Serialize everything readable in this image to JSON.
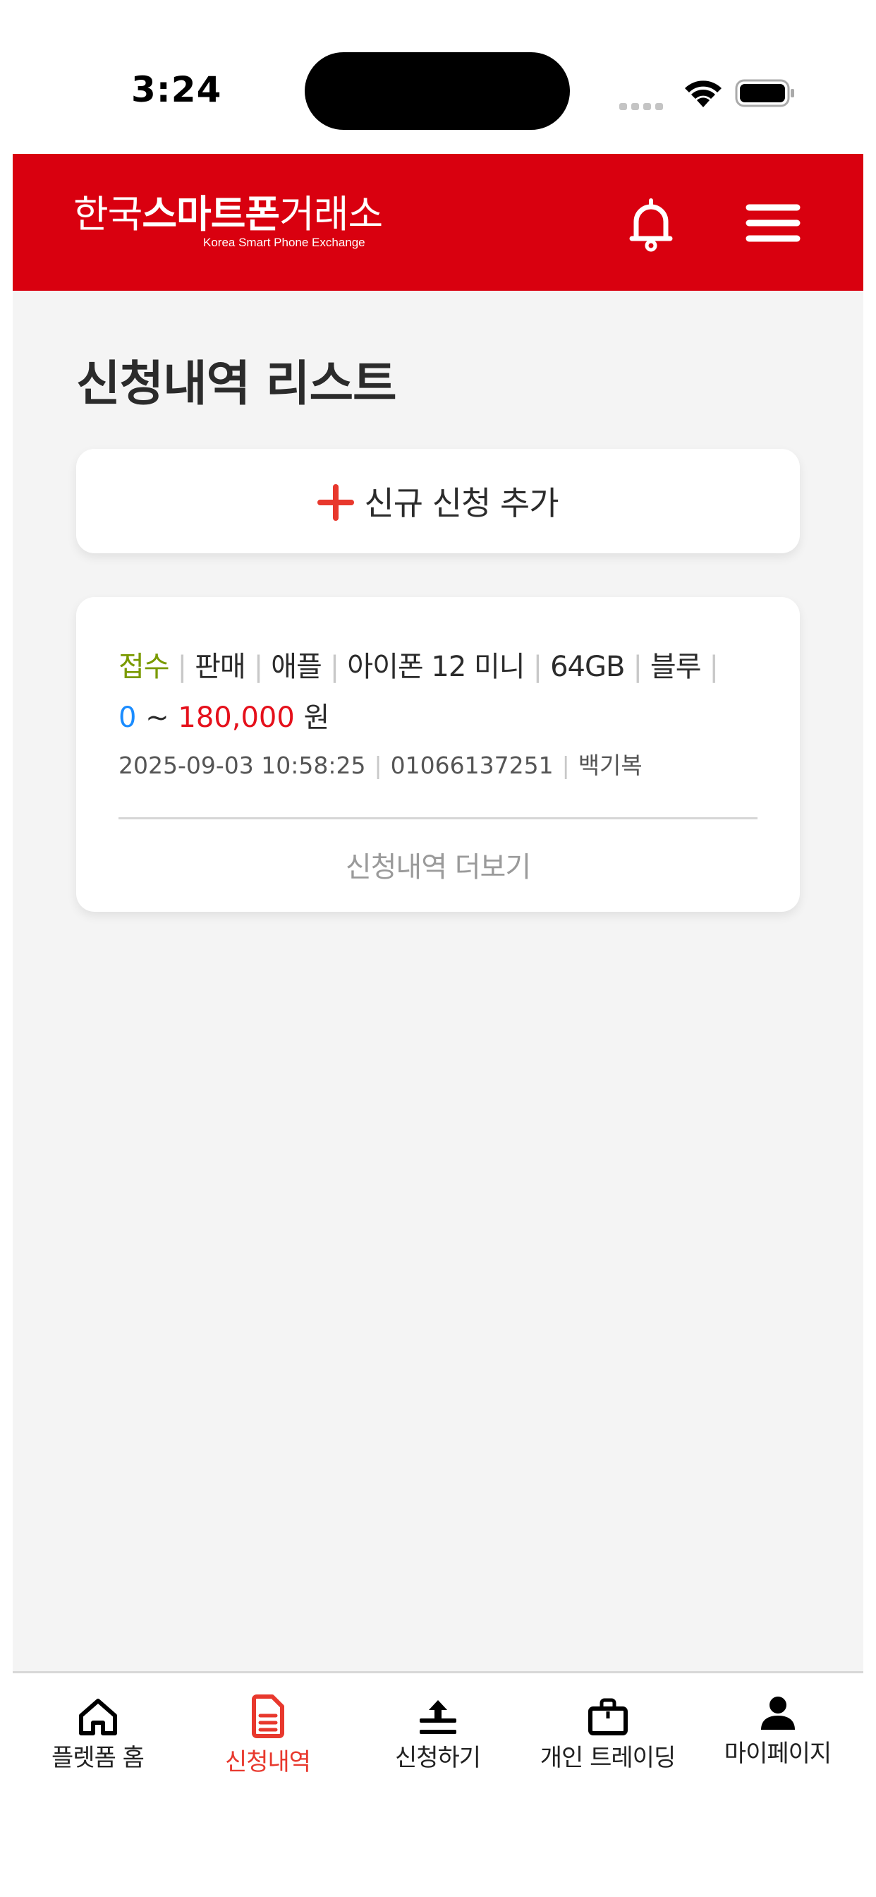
{
  "status_bar": {
    "time": "3:24",
    "icons": [
      "cellular-signal-icon",
      "wifi-icon",
      "battery-icon"
    ]
  },
  "header": {
    "logo_part1": "한국",
    "logo_part2": "스마트폰",
    "logo_part3": "거래소",
    "logo_subtitle": "Korea Smart Phone Exchange",
    "icons": [
      "bell-icon",
      "hamburger-menu-icon"
    ],
    "color": "#d9000f"
  },
  "page": {
    "title": "신청내역 리스트",
    "add_button_label": "신규 신청 추가"
  },
  "request": {
    "status": "접수",
    "type": "판매",
    "brand": "애플",
    "model": "아이폰 12 미니",
    "capacity": "64GB",
    "color": "블루",
    "price_min": "0",
    "price_tilde": "~",
    "price_max": "180,000",
    "currency": "원",
    "datetime": "2025-09-03 10:58:25",
    "phone": "01066137251",
    "name": "백기복",
    "more_label": "신청내역 더보기",
    "status_color": "#7a9a00",
    "min_color": "#1a8cff",
    "max_color": "#e5101b"
  },
  "tabbar": {
    "active_color": "#e8382d",
    "items": [
      {
        "label": "플렛폼 홈",
        "icon": "home-icon"
      },
      {
        "label": "신청내역",
        "icon": "document-icon"
      },
      {
        "label": "신청하기",
        "icon": "upload-icon"
      },
      {
        "label": "개인 트레이딩",
        "icon": "briefcase-icon"
      },
      {
        "label": "마이페이지",
        "icon": "user-icon"
      }
    ]
  }
}
